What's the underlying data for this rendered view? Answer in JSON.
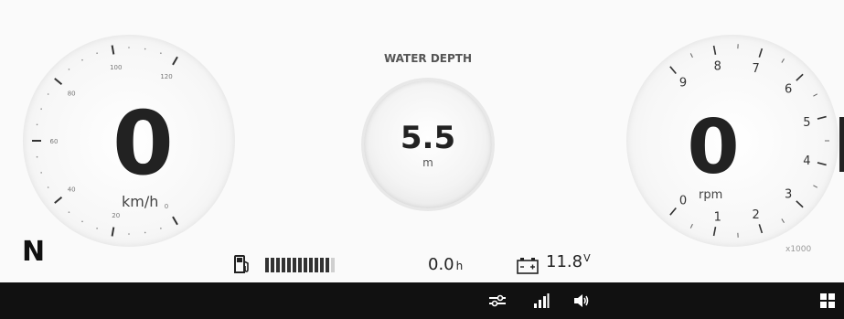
{
  "speedometer": {
    "value": "0",
    "unit": "km/h",
    "ticks": [
      "0",
      "20",
      "40",
      "60",
      "80",
      "100",
      "120"
    ]
  },
  "gear": "N",
  "water_depth": {
    "title": "WATER DEPTH",
    "value": "5.5",
    "unit": "m"
  },
  "tachometer": {
    "value": "0",
    "unit": "rpm",
    "multiplier": "x1000",
    "ticks": [
      "0",
      "1",
      "2",
      "3",
      "4",
      "5",
      "6",
      "7",
      "8",
      "9"
    ]
  },
  "status": {
    "fuel_level": 0.92,
    "engine_hours": "0.0",
    "engine_hours_unit": "h",
    "battery_voltage": "11.8",
    "battery_unit": "V"
  },
  "bottom_bar": {
    "icons": [
      "trim-icon",
      "signal-icon",
      "volume-icon",
      "apps-grid-icon"
    ]
  },
  "colors": {
    "background": "#fafafa",
    "bar": "#111111",
    "text": "#222222"
  }
}
